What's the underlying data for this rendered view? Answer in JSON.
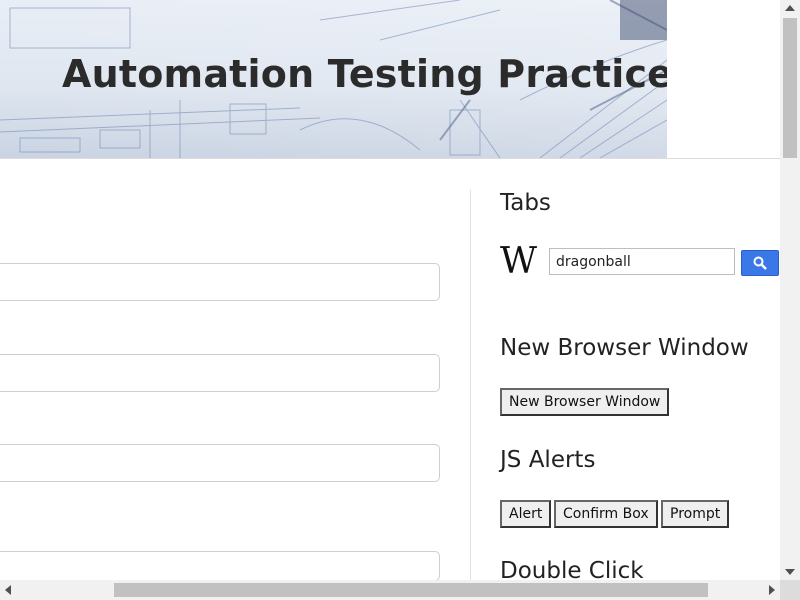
{
  "header": {
    "title": "Automation Testing Practice"
  },
  "sidebar": {
    "tabs": {
      "title": "Tabs",
      "wiki_logo": "W",
      "search_value": "dragonball",
      "search_icon": "magnifier-icon"
    },
    "new_window": {
      "title": "New Browser Window",
      "button_label": "New Browser Window"
    },
    "alerts": {
      "title": "JS Alerts",
      "buttons": [
        "Alert",
        "Confirm Box",
        "Prompt"
      ]
    },
    "double_click": {
      "title": "Double Click"
    }
  },
  "colors": {
    "search_button": "#3b78e7",
    "title_text": "#2b2b2b"
  }
}
